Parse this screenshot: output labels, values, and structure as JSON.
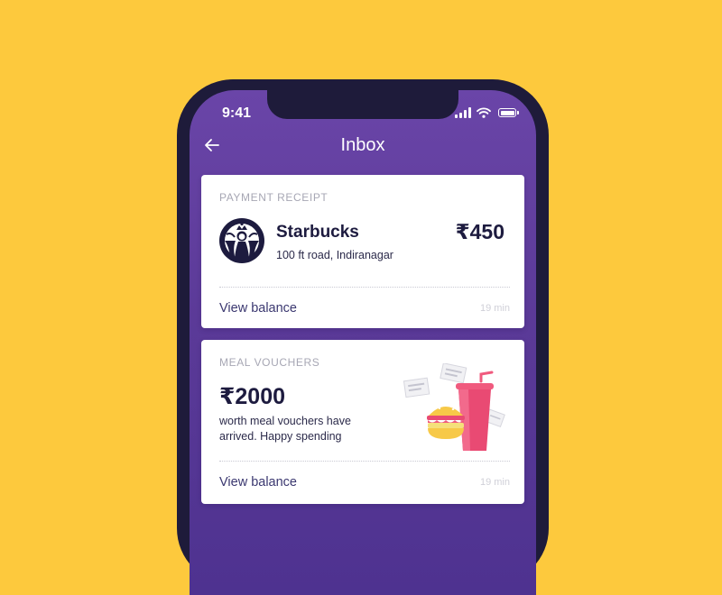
{
  "status_bar": {
    "time": "9:41"
  },
  "nav": {
    "title": "Inbox"
  },
  "cards": [
    {
      "label": "PAYMENT RECEIPT",
      "merchant": "Starbucks",
      "address": "100 ft road, Indiranagar",
      "amount": "₹450",
      "action": "View balance",
      "timestamp": "19 min"
    },
    {
      "label": "MEAL VOUCHERS",
      "amount": "₹2000",
      "description": "worth meal vouchers have arrived. Happy spending",
      "action": "View balance",
      "timestamp": "19 min"
    }
  ],
  "colors": {
    "background": "#FDC93D",
    "header": "#5B3A98",
    "text_dark": "#1D1B3F",
    "link": "#3B3870"
  },
  "icons": [
    "back-arrow-icon",
    "signal-icon",
    "wifi-icon",
    "battery-icon",
    "starbucks-logo",
    "burger-drink-illustration"
  ]
}
